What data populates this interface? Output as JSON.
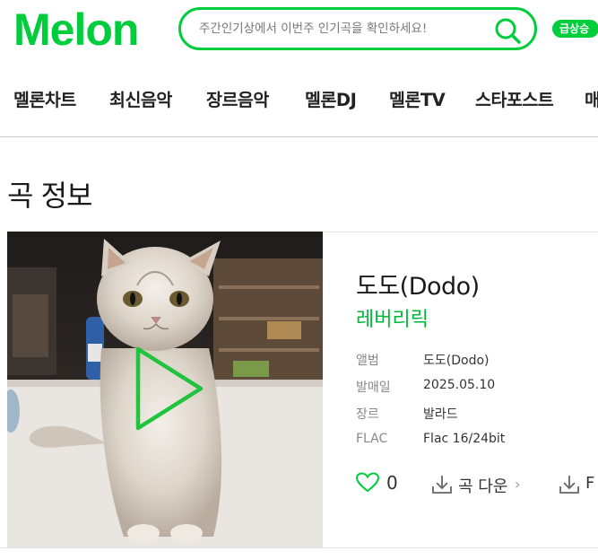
{
  "header": {
    "logo": "Melon",
    "search_placeholder": "주간인기상에서 이번주 인기곡을 확인하세요!",
    "trend_badge": "급상승"
  },
  "nav": {
    "items": [
      "멜론차트",
      "최신음악",
      "장르음악",
      "멜론DJ",
      "멜론TV",
      "스타포스트",
      "매"
    ]
  },
  "page": {
    "section_title": "곡 정보"
  },
  "song": {
    "title": "도도(Dodo)",
    "artist": "레버리릭",
    "meta": [
      {
        "key": "앨범",
        "value": "도도(Dodo)"
      },
      {
        "key": "발매일",
        "value": "2025.05.10"
      },
      {
        "key": "장르",
        "value": "발라드"
      },
      {
        "key": "FLAC",
        "value": "Flac 16/24bit"
      }
    ],
    "like_count": "0",
    "download_label": "곡 다운",
    "flac_download_label": "F"
  },
  "colors": {
    "brand": "#00cd3c",
    "artist": "#00b83a"
  }
}
